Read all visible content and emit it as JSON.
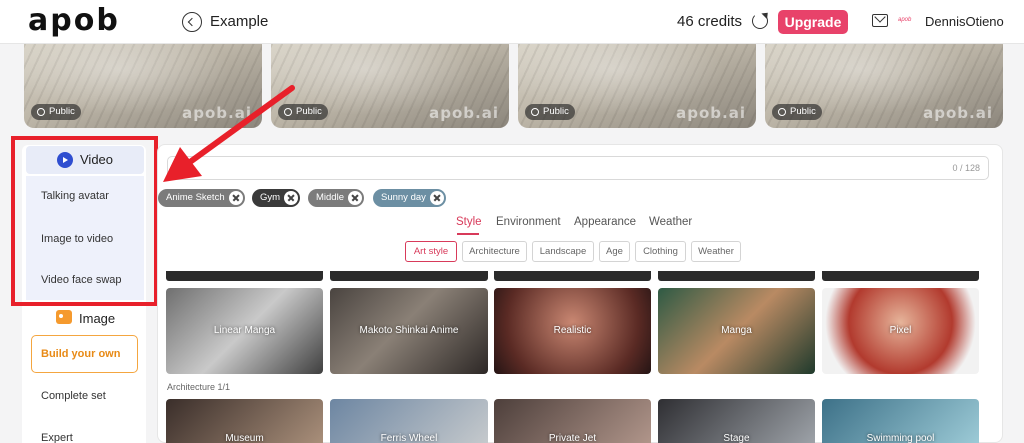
{
  "header": {
    "logo": "apob",
    "title": "Example",
    "credits": "46 credits",
    "upgrade_label": "Upgrade",
    "brand_mini": "apob",
    "username": "DennisOtieno"
  },
  "gallery": {
    "badge": "Public",
    "watermark": "apob.ai"
  },
  "sidebar": {
    "video_label": "Video",
    "video_items": [
      "Talking avatar",
      "Image to video",
      "Video face swap"
    ],
    "image_label": "Image",
    "build_label": "Build your own",
    "items": [
      "Complete set",
      "Expert"
    ]
  },
  "prompt": {
    "count": "0 / 128"
  },
  "tags": [
    "Anime Sketch",
    "Gym",
    "Middle",
    "Sunny day"
  ],
  "category_tabs": [
    "Style",
    "Environment",
    "Appearance",
    "Weather"
  ],
  "chips": [
    "Art style",
    "Architecture",
    "Landscape",
    "Age",
    "Clothing",
    "Weather"
  ],
  "styles": [
    "Linear Manga",
    "Makoto Shinkai Anime",
    "Realistic",
    "Manga",
    "Pixel"
  ],
  "section_label": "Architecture  1/1",
  "bottom_styles": [
    "Museum",
    "Ferris Wheel",
    "Private Jet",
    "Stage",
    "Swimming pool"
  ],
  "colors": {
    "accent": "#e8426a",
    "warning": "#e8202a",
    "video_icon": "#2f4ed0",
    "image_icon": "#f59a2e"
  }
}
